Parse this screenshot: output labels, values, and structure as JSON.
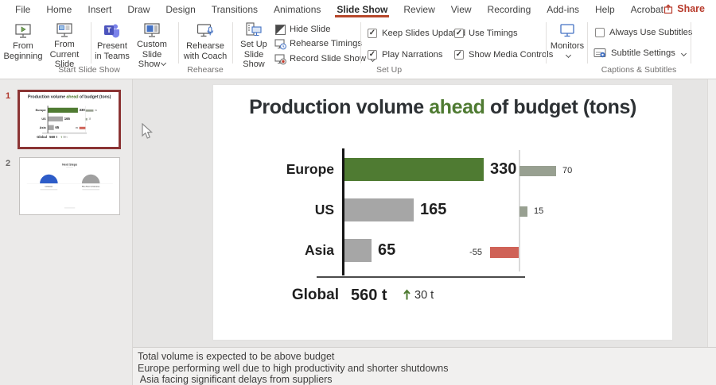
{
  "menubar": {
    "items": [
      {
        "label": "File"
      },
      {
        "label": "Home"
      },
      {
        "label": "Insert"
      },
      {
        "label": "Draw"
      },
      {
        "label": "Design"
      },
      {
        "label": "Transitions"
      },
      {
        "label": "Animations"
      },
      {
        "label": "Slide Show",
        "active": true
      },
      {
        "label": "Review"
      },
      {
        "label": "View"
      },
      {
        "label": "Recording"
      },
      {
        "label": "Add-ins"
      },
      {
        "label": "Help"
      },
      {
        "label": "Acrobat"
      }
    ],
    "share_label": "Share"
  },
  "ribbon": {
    "buttons": {
      "from_beginning": {
        "line1": "From",
        "line2": "Beginning"
      },
      "from_current": {
        "line1": "From",
        "line2": "Current Slide"
      },
      "present_teams": {
        "line1": "Present",
        "line2": "in Teams"
      },
      "custom_show": {
        "line1": "Custom Slide",
        "line2": "Show"
      },
      "rehearse_coach": {
        "line1": "Rehearse",
        "line2": "with Coach"
      },
      "setup_show": {
        "line1": "Set Up",
        "line2": "Slide Show"
      },
      "monitors": {
        "line1": "Monitors"
      },
      "hide_slide": "Hide Slide",
      "rehearse_timings": "Rehearse Timings",
      "record_show": "Record Slide Show",
      "subtitle_settings": "Subtitle Settings"
    },
    "checkboxes": [
      {
        "label": "Keep Slides Updated",
        "checked": true
      },
      {
        "label": "Play Narrations",
        "checked": true
      },
      {
        "label": "Use Timings",
        "checked": true
      },
      {
        "label": "Show Media Controls",
        "checked": true
      },
      {
        "label": "Always Use Subtitles",
        "checked": false
      }
    ],
    "group_labels": {
      "start": "Start Slide Show",
      "rehearse": "Rehearse",
      "setup": "Set Up",
      "captions": "Captions & Subtitles"
    }
  },
  "thumbnails": {
    "slide1_number": "1",
    "slide2_number": "2",
    "slide2": {
      "title": "Next Steps",
      "item1": "Celebrate",
      "item2": "Plan Next Celebration"
    }
  },
  "slide": {
    "chart_data": {
      "type": "bar",
      "title_prefix": "Production volume ",
      "title_highlight": "ahead",
      "title_suffix": " of budget (tons)",
      "categories": [
        "Europe",
        "US",
        "Asia"
      ],
      "values": [
        330,
        165,
        65
      ],
      "variances": [
        70,
        15,
        -55
      ],
      "highlight_category": "Europe",
      "total": {
        "label": "Global",
        "value": "560 t",
        "variance": "30 t"
      },
      "xlim_main": [
        0,
        340
      ],
      "legend": "none",
      "colors": {
        "highlight_bar": "#4f7b32",
        "bar": "#a6a6a6",
        "variance_bar": "#98a091",
        "variance_negative": "#cf6257",
        "title_highlight": "#4f7b32",
        "tab_accent": "#b7472a"
      }
    }
  },
  "notes": {
    "lines": [
      "Total volume is expected to be above budget",
      "Europe performing well due to high productivity and shorter shutdowns",
      " Asia facing significant delays from suppliers"
    ]
  }
}
